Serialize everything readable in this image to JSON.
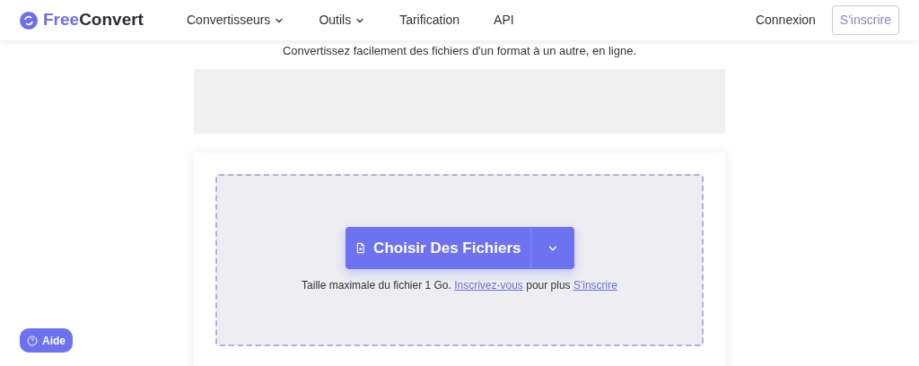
{
  "header": {
    "logo": {
      "part1": "Free",
      "part2": "Convert"
    },
    "nav": [
      {
        "label": "Convertisseurs",
        "dropdown": true
      },
      {
        "label": "Outils",
        "dropdown": true
      },
      {
        "label": "Tarification",
        "dropdown": false
      },
      {
        "label": "API",
        "dropdown": false
      }
    ],
    "login": "Connexion",
    "signup": "S'inscrire"
  },
  "subtitle": "Convertissez facilement des fichiers d'un format à un autre, en ligne.",
  "upload": {
    "button": "Choisir Des Fichiers",
    "note": "Taille maximale du fichier 1 Go.",
    "link1": "Inscrivez-vous",
    "middle": "pour plus",
    "link2": "S'inscrire"
  },
  "help": "Aide"
}
